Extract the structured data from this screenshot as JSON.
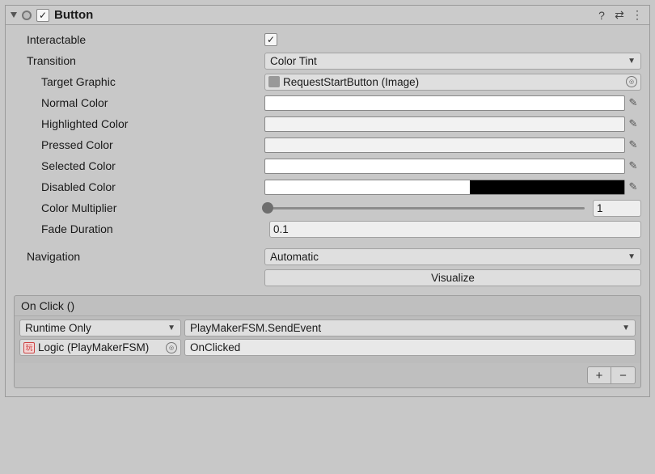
{
  "header": {
    "title": "Button",
    "enabled": true
  },
  "fields": {
    "interactable": {
      "label": "Interactable",
      "checked": true
    },
    "transition": {
      "label": "Transition",
      "value": "Color Tint"
    },
    "targetGraphic": {
      "label": "Target Graphic",
      "value": "RequestStartButton (Image)"
    },
    "normalColor": {
      "label": "Normal Color"
    },
    "highlightedColor": {
      "label": "Highlighted Color"
    },
    "pressedColor": {
      "label": "Pressed Color"
    },
    "selectedColor": {
      "label": "Selected Color"
    },
    "disabledColor": {
      "label": "Disabled Color"
    },
    "colorMultiplier": {
      "label": "Color Multiplier",
      "value": "1"
    },
    "fadeDuration": {
      "label": "Fade Duration",
      "value": "0.1"
    },
    "navigation": {
      "label": "Navigation",
      "value": "Automatic"
    },
    "visualize": {
      "label": "Visualize"
    }
  },
  "event": {
    "title": "On Click ()",
    "callState": "Runtime Only",
    "method": "PlayMakerFSM.SendEvent",
    "target": "Logic (PlayMakerFSM)",
    "arg": "OnClicked"
  }
}
